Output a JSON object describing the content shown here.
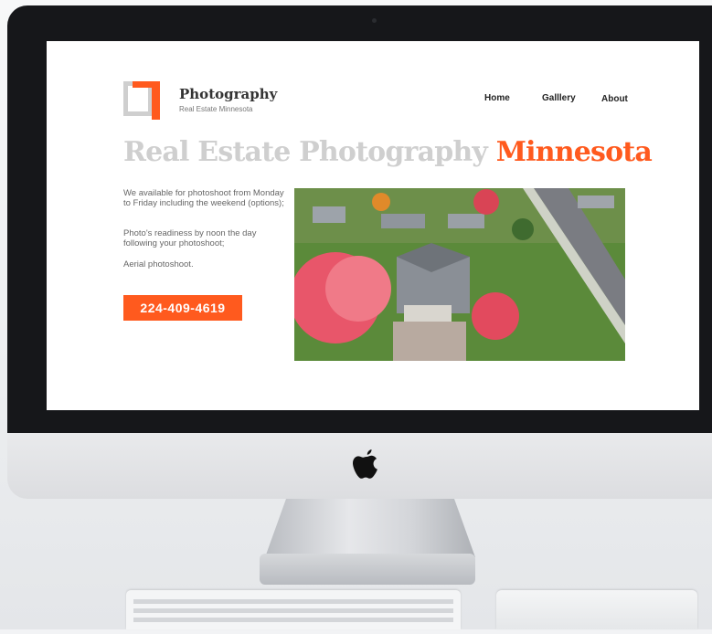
{
  "brand": {
    "title": "Photography",
    "subtitle": "Real Estate Minnesota"
  },
  "nav": {
    "items": [
      "Home",
      "Galllery",
      "About"
    ]
  },
  "hero": {
    "title_part1": "Real Estate Photography",
    "title_part2": "Minnesota"
  },
  "description": [
    "We available for photoshoot from Monday to Friday including the weekend (options);",
    "Photo's readiness by noon the day following your photoshoot;",
    "Aerial photoshoot."
  ],
  "cta": {
    "phone": "224-409-4619"
  },
  "colors": {
    "accent": "#ff5a1e",
    "muted_title": "#cfcfcf",
    "bezel": "#16171a"
  },
  "icons": {
    "device_logo": "apple-icon"
  }
}
